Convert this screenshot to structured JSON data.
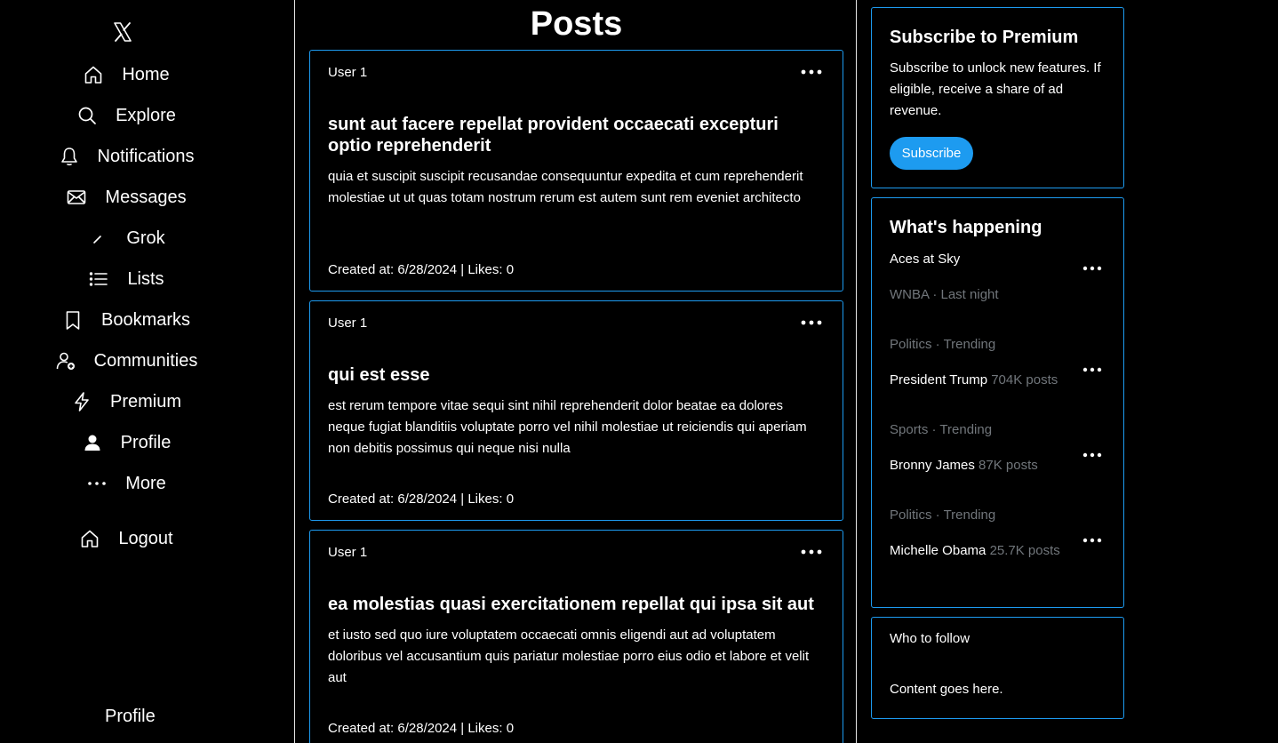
{
  "sidebar": {
    "logo_icon": "x-logo-icon",
    "items": [
      {
        "label": "Home",
        "icon": "home-icon"
      },
      {
        "label": "Explore",
        "icon": "search-icon"
      },
      {
        "label": "Notifications",
        "icon": "bell-icon"
      },
      {
        "label": "Messages",
        "icon": "envelope-icon"
      },
      {
        "label": "Grok",
        "icon": "grok-icon"
      },
      {
        "label": "Lists",
        "icon": "list-icon"
      },
      {
        "label": "Bookmarks",
        "icon": "bookmark-icon"
      },
      {
        "label": "Communities",
        "icon": "communities-icon"
      },
      {
        "label": "Premium",
        "icon": "lightning-icon"
      },
      {
        "label": "Profile",
        "icon": "person-icon"
      },
      {
        "label": "More",
        "icon": "more-dots-icon"
      }
    ],
    "logout": {
      "label": "Logout",
      "icon": "home-icon"
    },
    "footer_profile": "Profile"
  },
  "main": {
    "title": "Posts",
    "posts": [
      {
        "user": "User 1",
        "title": "sunt aut facere repellat provident occaecati excepturi optio reprehenderit",
        "body": "quia et suscipit suscipit recusandae consequuntur expedita et cum reprehenderit molestiae ut ut quas totam nostrum rerum est autem sunt rem eveniet architecto",
        "meta": "Created at: 6/28/2024 | Likes: 0"
      },
      {
        "user": "User 1",
        "title": "qui est esse",
        "body": "est rerum tempore vitae sequi sint nihil reprehenderit dolor beatae ea dolores neque fugiat blanditiis voluptate porro vel nihil molestiae ut reiciendis qui aperiam non debitis possimus qui neque nisi nulla",
        "meta": "Created at: 6/28/2024 | Likes: 0"
      },
      {
        "user": "User 1",
        "title": "ea molestias quasi exercitationem repellat qui ipsa sit aut",
        "body": "et iusto sed quo iure voluptatem occaecati omnis eligendi aut ad voluptatem doloribus vel accusantium quis pariatur molestiae porro eius odio et labore et velit aut",
        "meta": "Created at: 6/28/2024 | Likes: 0"
      }
    ]
  },
  "right": {
    "premium": {
      "title": "Subscribe to Premium",
      "text": "Subscribe to unlock new features. If eligible, receive a share of ad revenue.",
      "button": "Subscribe"
    },
    "happening": {
      "title": "What's happening",
      "trends": [
        {
          "category": "",
          "name": "Aces at Sky",
          "count": ""
        },
        {
          "category": "WNBA · Last night",
          "name": "",
          "count": ""
        },
        {
          "category": "Politics · Trending",
          "name": "President Trump",
          "count": "704K posts"
        },
        {
          "category": "Sports · Trending",
          "name": "Bronny James",
          "count": "87K posts"
        },
        {
          "category": "Politics · Trending",
          "name": "Michelle Obama",
          "count": "25.7K posts"
        }
      ]
    },
    "follow": {
      "title": "Who to follow",
      "content": "Content goes here."
    }
  },
  "colors": {
    "background": "#000000",
    "accent": "#1d9bf0",
    "muted": "#71767b",
    "text": "#ffffff"
  }
}
